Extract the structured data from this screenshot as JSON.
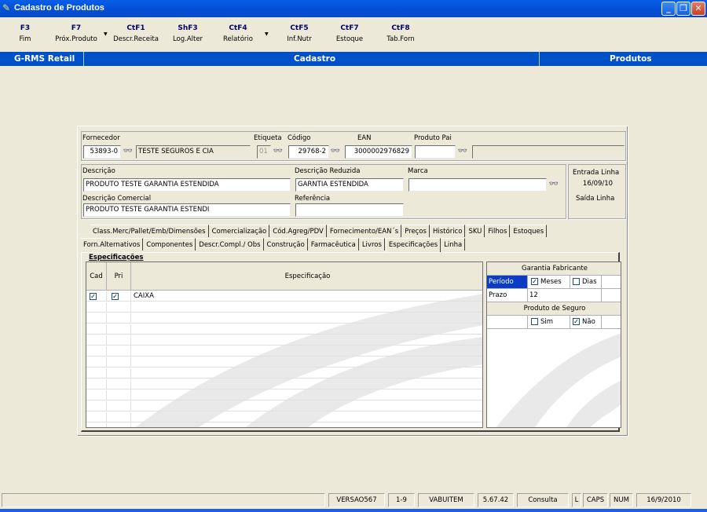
{
  "window": {
    "title": "Cadastro de Produtos"
  },
  "toolbar": {
    "items": [
      {
        "key": "F3",
        "label": "Fim"
      },
      {
        "key": "F7",
        "label": "Próx.Produto"
      },
      {
        "key": "CtF1",
        "label": "Descr.Receita"
      },
      {
        "key": "ShF3",
        "label": "Log.Alter"
      },
      {
        "key": "CtF4",
        "label": "Relatório"
      },
      {
        "key": "CtF5",
        "label": "Inf.Nutr"
      },
      {
        "key": "CtF7",
        "label": "Estoque"
      },
      {
        "key": "CtF8",
        "label": "Tab.Forn"
      }
    ]
  },
  "bluebar": {
    "left": "G-RMS Retail",
    "center": "Cadastro",
    "right": "Produtos"
  },
  "form": {
    "fornecedor_label": "Fornecedor",
    "fornecedor_code": "53893-0",
    "fornecedor_name": "TESTE SEGUROS E CIA",
    "etiqueta_label": "Etiqueta",
    "etiqueta": "01",
    "codigo_label": "Código",
    "codigo": "29768-2",
    "ean_label": "EAN",
    "ean": "3000002976829",
    "produto_pai_label": "Produto Pai",
    "produto_pai": "",
    "descricao_label": "Descrição",
    "descricao": "PRODUTO TESTE GARANTIA ESTENDIDA",
    "descricao_reduzida_label": "Descrição Reduzida",
    "descricao_reduzida": "GARNTIA ESTENDIDA",
    "marca_label": "Marca",
    "marca": "",
    "descricao_comercial_label": "Descrição Comercial",
    "descricao_comercial": "PRODUTO TESTE GARANTIA ESTENDI",
    "referencia_label": "Referência",
    "referencia": "",
    "entrada_linha_label": "Entrada Linha",
    "entrada_linha": "16/09/10",
    "saida_linha_label": "Saída Linha",
    "saida_linha": ""
  },
  "tabs_row1": [
    "Class.Merc/Pallet/Emb/Dimensões",
    "Comercialização",
    "Cód.Agreg/PDV",
    "Fornecimento/EAN´s",
    "Preços",
    "Histórico",
    "SKU",
    "Filhos",
    "Estoques"
  ],
  "tabs_row2": [
    "Forn.Alternativos",
    "Componentes",
    "Descr.Compl./ Obs",
    "Construção",
    "Farmacêutica",
    "Livros",
    "Especificações",
    "Linha"
  ],
  "specs": {
    "group_title": "Especificações",
    "headers": {
      "cad": "Cad",
      "pri": "Pri",
      "spec": "Especificação"
    },
    "rows": [
      {
        "cad": true,
        "pri": true,
        "spec": "CAIXA"
      }
    ]
  },
  "garantia": {
    "title": "Garantia Fabricante",
    "periodo_label": "Período",
    "meses_label": "Meses",
    "meses_checked": true,
    "dias_label": "Dias",
    "dias_checked": false,
    "prazo_label": "Prazo",
    "prazo": "12",
    "seguro_title": "Produto de Seguro",
    "sim_label": "Sim",
    "sim_checked": false,
    "nao_label": "Não",
    "nao_checked": true
  },
  "status": [
    "VERSAO567",
    "1-9",
    "VABUITEM",
    "5.67.42",
    "Consulta",
    "L",
    "CAPS",
    "NUM",
    "16/9/2010"
  ],
  "colors": {
    "title_blue": "#0a5ee8",
    "bar_blue": "#0050c8",
    "selected_cell": "#0a3cc8"
  }
}
